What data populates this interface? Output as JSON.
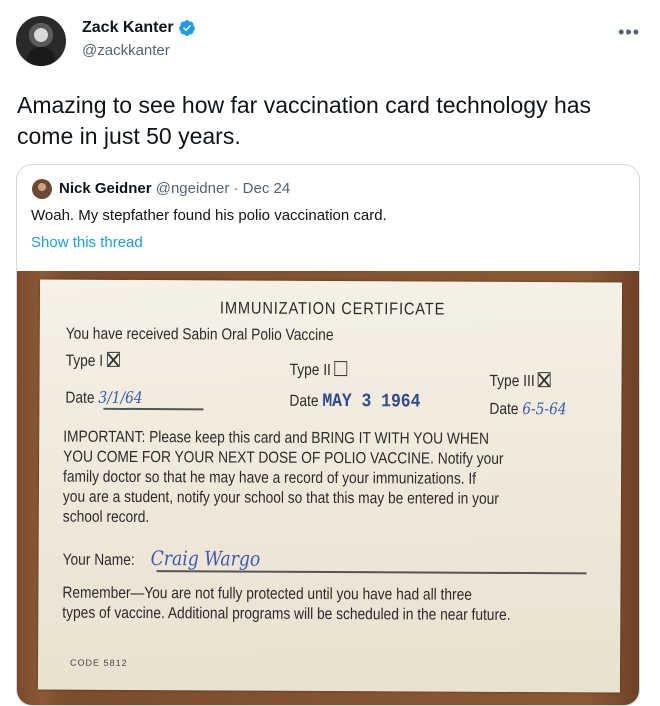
{
  "author": {
    "name": "Zack Kanter",
    "handle": "@zackkanter",
    "verified_color": "#1d9bf0"
  },
  "more_icon": "more-horizontal-icon",
  "tweet_text": "Amazing to see how far vaccination card technology has come in just 50 years.",
  "quote": {
    "name": "Nick Geidner",
    "handle": "@ngeidner",
    "separator": "·",
    "date": "Dec 24",
    "text": "Woah. My stepfather found his polio vaccination card.",
    "show_thread": "Show this thread",
    "card": {
      "title": "IMMUNIZATION CERTIFICATE",
      "subtitle": "You have received Sabin Oral Polio Vaccine",
      "type1": "Type I",
      "type2": "Type II",
      "type3": "Type III",
      "date_label": "Date",
      "date1": "3/1/64",
      "date2": "MAY 3 1964",
      "date3": "6-5-64",
      "important_lines": [
        "IMPORTANT: Please keep this card and BRING IT WITH YOU WHEN",
        "YOU COME FOR YOUR NEXT DOSE OF POLIO VACCINE. Notify your",
        "family doctor so that he may have a record of your immunizations. If",
        "you are a student, notify your school so that this may be entered in your",
        "school record."
      ],
      "your_name_label": "Your Name:",
      "your_name_value": "Craig Wargo",
      "remember_lines": [
        "Remember—You are not fully protected until you have had all three",
        "types of vaccine. Additional programs will be scheduled in the near future."
      ],
      "code": "CODE 5812"
    }
  },
  "colors": {
    "link": "#1d9bf0",
    "text": "#0f1419",
    "secondary": "#536471",
    "border": "#cfd9de"
  }
}
